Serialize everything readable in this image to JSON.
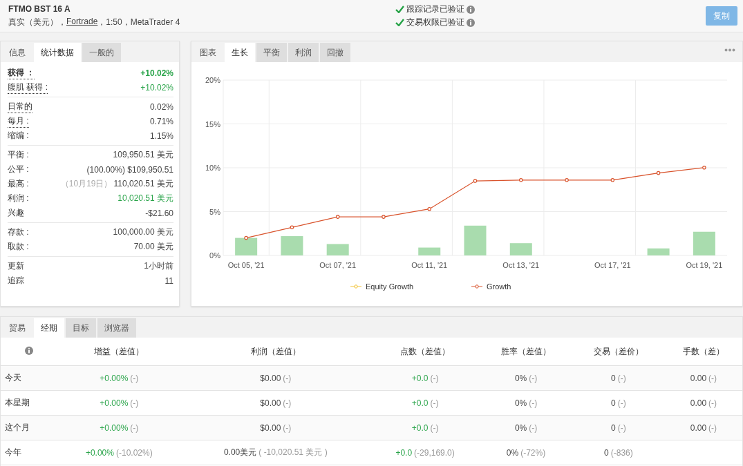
{
  "header": {
    "title": "FTMO BST 16 A",
    "subtitle_parts": [
      {
        "text": "真实（美元），",
        "link": false
      },
      {
        "text": "Fortrade",
        "link": true
      },
      {
        "text": "，1:50，MetaTrader 4",
        "link": false
      }
    ],
    "verifications": [
      {
        "label": "跟踪记录已验证",
        "verified": true
      },
      {
        "label": "交易权限已验证",
        "verified": true
      }
    ],
    "copy_button": {
      "label": "复制",
      "disabled": true
    }
  },
  "stats_panel": {
    "tabs": [
      {
        "label": "信息",
        "selected": false
      },
      {
        "label": "统计数据",
        "selected": true
      },
      {
        "label": "一般的",
        "selected": false
      }
    ],
    "groups": [
      [
        {
          "label": "获得 ：",
          "value": "+10.02%",
          "hint": true,
          "positive": true,
          "bold": true
        },
        {
          "label": "腹肌 获得 :",
          "value": "+10.02%",
          "hint": true,
          "positive": true,
          "bold": false
        }
      ],
      [
        {
          "label": "日常的",
          "value": "0.02%",
          "hint": true,
          "positive": false,
          "bold": false
        },
        {
          "label": "每月 :",
          "value": "0.71%",
          "hint": true,
          "positive": false,
          "bold": false
        },
        {
          "label": "缩编 :",
          "value": "1.15%",
          "hint": false,
          "positive": false,
          "bold": false
        }
      ],
      [
        {
          "label": "平衡 :",
          "value": "109,950.51 美元",
          "hint": false,
          "positive": false,
          "bold": false
        },
        {
          "label": "公平 :",
          "value": "(100.00%) $109,950.51",
          "hint": false,
          "positive": false,
          "bold": false
        },
        {
          "label": "最高 :",
          "note": "（10月19日）",
          "value": "110,020.51 美元",
          "hint": false,
          "positive": false,
          "bold": false
        },
        {
          "label": "利润 :",
          "value": "10,020.51 美元",
          "hint": false,
          "positive": true,
          "bold": false
        },
        {
          "label": "兴趣",
          "value": "-$21.60",
          "hint": false,
          "positive": false,
          "bold": false
        }
      ],
      [
        {
          "label": "存款 :",
          "value": "100,000.00 美元",
          "hint": false,
          "positive": false,
          "bold": false
        },
        {
          "label": "取款 :",
          "value": "70.00 美元",
          "hint": false,
          "positive": false,
          "bold": false
        }
      ],
      [
        {
          "label": "更新",
          "value": "1小时前",
          "hint": false,
          "positive": false,
          "bold": false
        },
        {
          "label": "追踪",
          "value": "11",
          "hint": false,
          "positive": false,
          "bold": false
        }
      ]
    ]
  },
  "chart_panel": {
    "tabs": [
      {
        "label": "图表",
        "selected": false
      },
      {
        "label": "生长",
        "selected": true
      },
      {
        "label": "平衡",
        "selected": false
      },
      {
        "label": "利润",
        "selected": false
      },
      {
        "label": "回撤",
        "selected": false
      }
    ],
    "chart_data": {
      "type": "line",
      "grid": true,
      "categories": [
        "Oct 05, '21",
        null,
        "Oct 07, '21",
        null,
        "Oct 11, '21",
        null,
        "Oct 13, '21",
        null,
        "Oct 17, '21",
        null,
        "Oct 19, '21"
      ],
      "ylim": [
        0,
        20
      ],
      "yticks": [
        {
          "value": 0,
          "label": "0%"
        },
        {
          "value": 5,
          "label": "5%"
        },
        {
          "value": 10,
          "label": "10%"
        },
        {
          "value": 15,
          "label": "15%"
        },
        {
          "value": 20,
          "label": "20%"
        }
      ],
      "series": [
        {
          "type": "bar",
          "color": "#a9dcae",
          "values": [
            2.0,
            2.2,
            1.3,
            null,
            0.9,
            3.4,
            1.4,
            null,
            null,
            0.8,
            2.7
          ]
        },
        {
          "name": "Equity Growth",
          "type": "line",
          "marker": "circle",
          "color": "#f2c230",
          "values": [
            null,
            null,
            null,
            null,
            null,
            null,
            null,
            null,
            null,
            null,
            null
          ]
        },
        {
          "name": "Growth",
          "type": "line",
          "marker": "circle",
          "color": "#d9532c",
          "values": [
            2.0,
            3.2,
            4.4,
            4.4,
            5.3,
            8.5,
            8.6,
            8.6,
            8.6,
            9.4,
            10.02
          ]
        }
      ]
    }
  },
  "periods_panel": {
    "tabs": [
      {
        "label": "贸易",
        "selected": false
      },
      {
        "label": "经期",
        "selected": true
      },
      {
        "label": "目标",
        "selected": false
      },
      {
        "label": "浏览器",
        "selected": false
      }
    ],
    "columns": [
      "增益（差值）",
      "利润（差值）",
      "点数（差值）",
      "胜率（差值）",
      "交易（差价）",
      "手数（差）"
    ],
    "rows": [
      {
        "label": "今天",
        "cells": [
          {
            "value": "+0.00%",
            "diff": "(-)",
            "positive": true
          },
          {
            "value": "$0.00",
            "diff": "(-)",
            "positive": false
          },
          {
            "value": "+0.0",
            "diff": "(-)",
            "positive": true
          },
          {
            "value": "0%",
            "diff": "(-)",
            "positive": false
          },
          {
            "value": "0",
            "diff": "(-)",
            "positive": false
          },
          {
            "value": "0.00",
            "diff": "(-)",
            "positive": false
          }
        ]
      },
      {
        "label": "本星期",
        "cells": [
          {
            "value": "+0.00%",
            "diff": "(-)",
            "positive": true
          },
          {
            "value": "$0.00",
            "diff": "(-)",
            "positive": false
          },
          {
            "value": "+0.0",
            "diff": "(-)",
            "positive": true
          },
          {
            "value": "0%",
            "diff": "(-)",
            "positive": false
          },
          {
            "value": "0",
            "diff": "(-)",
            "positive": false
          },
          {
            "value": "0.00",
            "diff": "(-)",
            "positive": false
          }
        ]
      },
      {
        "label": "这个月",
        "cells": [
          {
            "value": "+0.00%",
            "diff": "(-)",
            "positive": true
          },
          {
            "value": "$0.00",
            "diff": "(-)",
            "positive": false
          },
          {
            "value": "+0.0",
            "diff": "(-)",
            "positive": true
          },
          {
            "value": "0%",
            "diff": "(-)",
            "positive": false
          },
          {
            "value": "0",
            "diff": "(-)",
            "positive": false
          },
          {
            "value": "0.00",
            "diff": "(-)",
            "positive": false
          }
        ]
      },
      {
        "label": "今年",
        "cells": [
          {
            "value": "+0.00%",
            "diff": "(-10.02%)",
            "positive": true
          },
          {
            "value": "0.00美元",
            "diff": "( -10,020.51 美元 )",
            "positive": false
          },
          {
            "value": "+0.0",
            "diff": "(-29,169.0)",
            "positive": true
          },
          {
            "value": "0%",
            "diff": "(-72%)",
            "positive": false
          },
          {
            "value": "0",
            "diff": "(-836)",
            "positive": false
          }
        ]
      }
    ]
  }
}
